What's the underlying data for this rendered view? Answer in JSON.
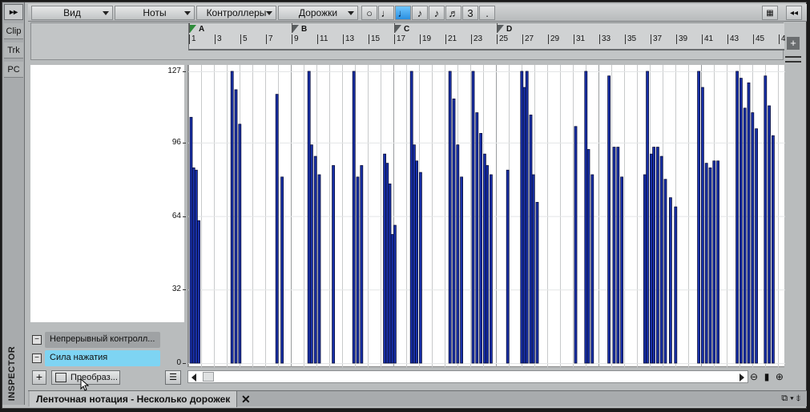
{
  "toolbar": {
    "collapse_left": "▸▸",
    "menus": [
      {
        "label": "Вид"
      },
      {
        "label": "Ноты"
      },
      {
        "label": "Контроллеры"
      },
      {
        "label": "Дорожки"
      }
    ],
    "note_values": [
      "○",
      "♩",
      "♩",
      "♪",
      "♪",
      "♬",
      "3",
      "."
    ],
    "active_note_index": 2,
    "collapse_right": "◂◂"
  },
  "left_strip": {
    "tabs": [
      "Clip",
      "Trk",
      "PC"
    ],
    "inspector_label": "INSPECTOR"
  },
  "ruler": {
    "markers": [
      "A",
      "B",
      "C",
      "D"
    ],
    "bar_numbers": [
      "1",
      "3",
      "5",
      "7",
      "9",
      "11",
      "13",
      "15",
      "17",
      "19",
      "21",
      "23",
      "25",
      "27",
      "29",
      "31",
      "33",
      "35",
      "37",
      "39",
      "41",
      "43",
      "45",
      "4"
    ]
  },
  "lanes": [
    {
      "label": "Непрерывный контролл...",
      "active": false
    },
    {
      "label": "Сила нажатия",
      "active": true
    }
  ],
  "controls": {
    "add_label": "+",
    "transform_label": "Преобраз...",
    "menu_label": "☰"
  },
  "tabbar": {
    "title": "Ленточная нотация - Несколько дорожек",
    "close": "✕",
    "right_icons": "⧉ ▾ ⇟"
  },
  "chart_data": {
    "type": "bar",
    "title": "",
    "ylabel": "",
    "ylim": [
      0,
      127
    ],
    "yticks": [
      0,
      32,
      64,
      96,
      127
    ],
    "x_unit": "bar",
    "values": [
      [
        1.0,
        107
      ],
      [
        1.1,
        85
      ],
      [
        1.2,
        84
      ],
      [
        1.3,
        62
      ],
      [
        2.6,
        127
      ],
      [
        2.75,
        119
      ],
      [
        2.9,
        104
      ],
      [
        4.35,
        117
      ],
      [
        4.55,
        81
      ],
      [
        5.6,
        127
      ],
      [
        5.7,
        95
      ],
      [
        5.85,
        90
      ],
      [
        6.0,
        82
      ],
      [
        6.55,
        86
      ],
      [
        7.35,
        127
      ],
      [
        7.5,
        81
      ],
      [
        7.65,
        86
      ],
      [
        8.55,
        91
      ],
      [
        8.65,
        87
      ],
      [
        8.75,
        78
      ],
      [
        8.85,
        56
      ],
      [
        8.95,
        60
      ],
      [
        9.6,
        127
      ],
      [
        9.7,
        95
      ],
      [
        9.8,
        88
      ],
      [
        9.95,
        83
      ],
      [
        11.1,
        127
      ],
      [
        11.25,
        115
      ],
      [
        11.4,
        95
      ],
      [
        11.55,
        81
      ],
      [
        12.0,
        127
      ],
      [
        12.15,
        109
      ],
      [
        12.3,
        100
      ],
      [
        12.45,
        91
      ],
      [
        12.55,
        86
      ],
      [
        12.7,
        82
      ],
      [
        13.35,
        84
      ],
      [
        13.9,
        127
      ],
      [
        14.0,
        120
      ],
      [
        14.1,
        127
      ],
      [
        14.25,
        108
      ],
      [
        14.35,
        82
      ],
      [
        14.5,
        70
      ],
      [
        16.0,
        103
      ],
      [
        16.4,
        127
      ],
      [
        16.5,
        93
      ],
      [
        16.65,
        82
      ],
      [
        17.3,
        125
      ],
      [
        17.5,
        94
      ],
      [
        17.65,
        94
      ],
      [
        17.8,
        81
      ],
      [
        18.7,
        82
      ],
      [
        18.8,
        127
      ],
      [
        18.95,
        91
      ],
      [
        19.05,
        94
      ],
      [
        19.2,
        94
      ],
      [
        19.35,
        90
      ],
      [
        19.5,
        80
      ],
      [
        19.7,
        72
      ],
      [
        19.9,
        68
      ],
      [
        20.8,
        127
      ],
      [
        20.95,
        120
      ],
      [
        21.1,
        87
      ],
      [
        21.25,
        85
      ],
      [
        21.4,
        88
      ],
      [
        21.55,
        88
      ],
      [
        22.3,
        127
      ],
      [
        22.45,
        124
      ],
      [
        22.6,
        111
      ],
      [
        22.75,
        122
      ],
      [
        22.9,
        109
      ],
      [
        23.05,
        102
      ],
      [
        23.4,
        125
      ],
      [
        23.55,
        112
      ],
      [
        23.7,
        99
      ],
      [
        24.7,
        110
      ],
      [
        24.85,
        106
      ],
      [
        25.0,
        96
      ],
      [
        25.15,
        90
      ],
      [
        25.3,
        88
      ],
      [
        25.5,
        84
      ],
      [
        26.6,
        101
      ],
      [
        26.75,
        98
      ],
      [
        26.9,
        96
      ],
      [
        27.05,
        93
      ],
      [
        27.25,
        90
      ],
      [
        28.0,
        127
      ],
      [
        28.15,
        95
      ],
      [
        28.3,
        80
      ],
      [
        29.0,
        127
      ],
      [
        29.15,
        95
      ],
      [
        29.3,
        85
      ],
      [
        29.5,
        45
      ],
      [
        30.05,
        77
      ],
      [
        30.2,
        32
      ],
      [
        30.35,
        59
      ],
      [
        30.5,
        60
      ]
    ]
  }
}
